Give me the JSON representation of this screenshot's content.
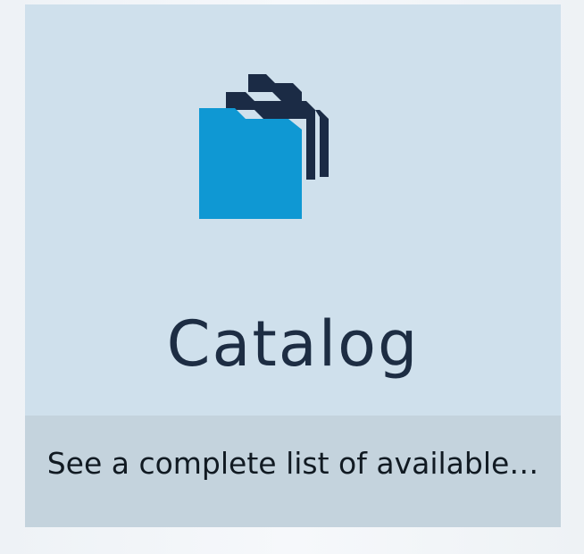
{
  "tile": {
    "title": "Catalog",
    "description": "See a complete list of available…",
    "icon": "folders-stack-icon"
  },
  "colors": {
    "tile_background": "#cfe0ec",
    "footer_background": "#c4d3dd",
    "front_folder": "#0f98d3",
    "back_folders": "#1b2b45",
    "title_text": "#1d2d43"
  }
}
